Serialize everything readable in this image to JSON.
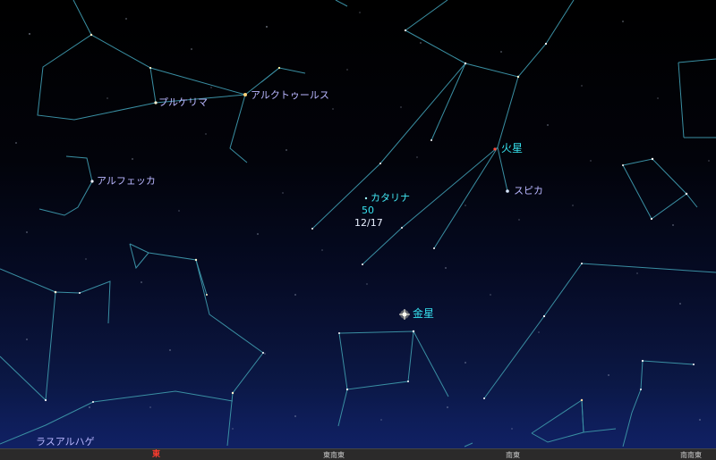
{
  "labels": {
    "pulcherrima": "プルケリマ",
    "arcturus": "アルクトゥールス",
    "alphecca": "アルフェッカ",
    "catalina": "カタリナ",
    "catalina_mag": "50",
    "catalina_date": "12/17",
    "mars": "火星",
    "spica": "スピカ",
    "venus": "金星",
    "rasalhague": "ラスアルハゲ"
  },
  "horizon": {
    "east": "東",
    "east_southeast": "東南東",
    "southeast": "南東",
    "south_southeast": "南南東"
  },
  "colors": {
    "constellation_line": "#3a8fa3",
    "star_label": "#b9b7ff",
    "planet_label": "#37e3f0",
    "cardinal_direction": "#ff3b2e",
    "mars": "#ff4a3a",
    "venus": "#ffffff"
  }
}
